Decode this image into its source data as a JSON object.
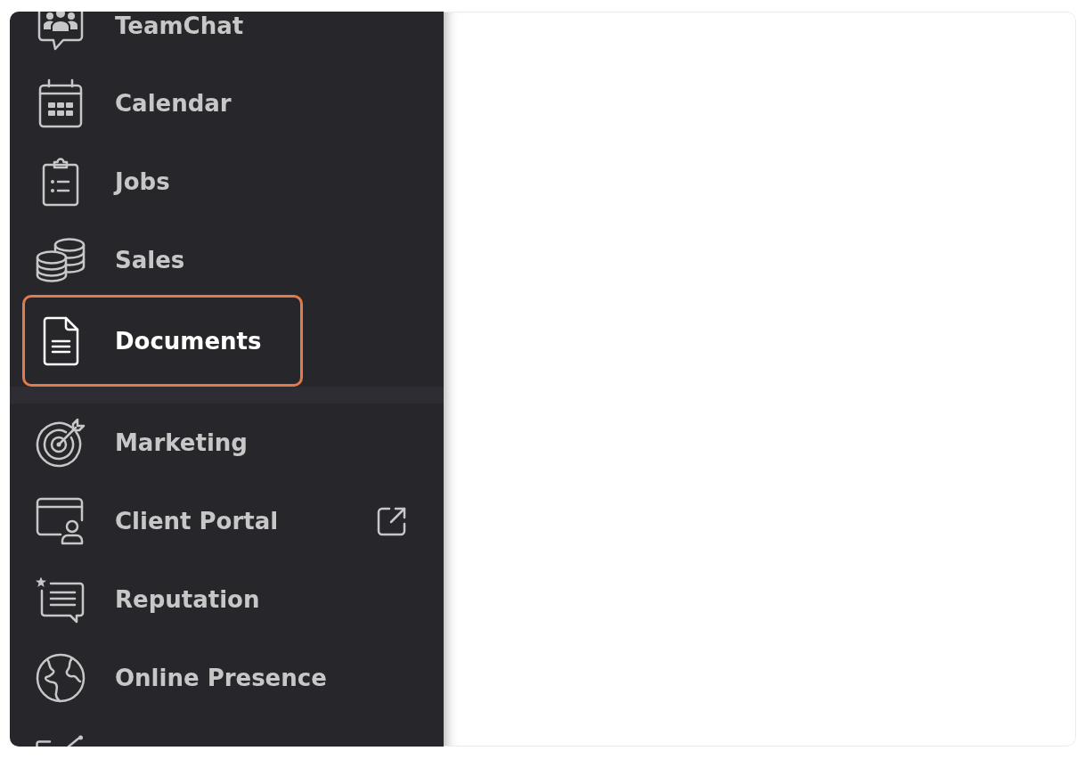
{
  "sidebar": {
    "groups": [
      {
        "items": [
          {
            "label": "TeamChat",
            "selected": false,
            "external": false
          },
          {
            "label": "Calendar",
            "selected": false,
            "external": false
          },
          {
            "label": "Jobs",
            "selected": false,
            "external": false
          },
          {
            "label": "Sales",
            "selected": false,
            "external": false
          },
          {
            "label": "Documents",
            "selected": true,
            "external": false
          }
        ]
      },
      {
        "items": [
          {
            "label": "Marketing",
            "selected": false,
            "external": false
          },
          {
            "label": "Client Portal",
            "selected": false,
            "external": true
          },
          {
            "label": "Reputation",
            "selected": false,
            "external": false
          },
          {
            "label": "Online Presence",
            "selected": false,
            "external": false
          }
        ]
      }
    ]
  }
}
